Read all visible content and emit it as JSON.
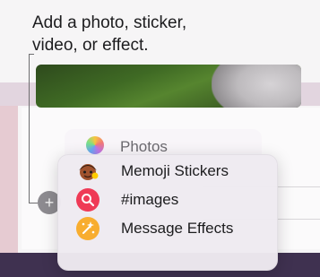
{
  "caption": {
    "line1": "Add a photo, sticker,",
    "line2": "video, or effect."
  },
  "menu": {
    "items": [
      {
        "label": "Photos",
        "icon": "photos-icon"
      },
      {
        "label": "Memoji Stickers",
        "icon": "memoji-icon"
      },
      {
        "label": "#images",
        "icon": "images-search-icon"
      },
      {
        "label": "Message Effects",
        "icon": "message-effects-icon"
      }
    ]
  },
  "plus_button": {
    "glyph": "+",
    "icon": "plus-icon"
  },
  "colors": {
    "images_icon": "#ef3a56",
    "effects_icon": "#f8ad2f",
    "dock": "#3f3150",
    "menu_bg": "#eeeaf1"
  }
}
